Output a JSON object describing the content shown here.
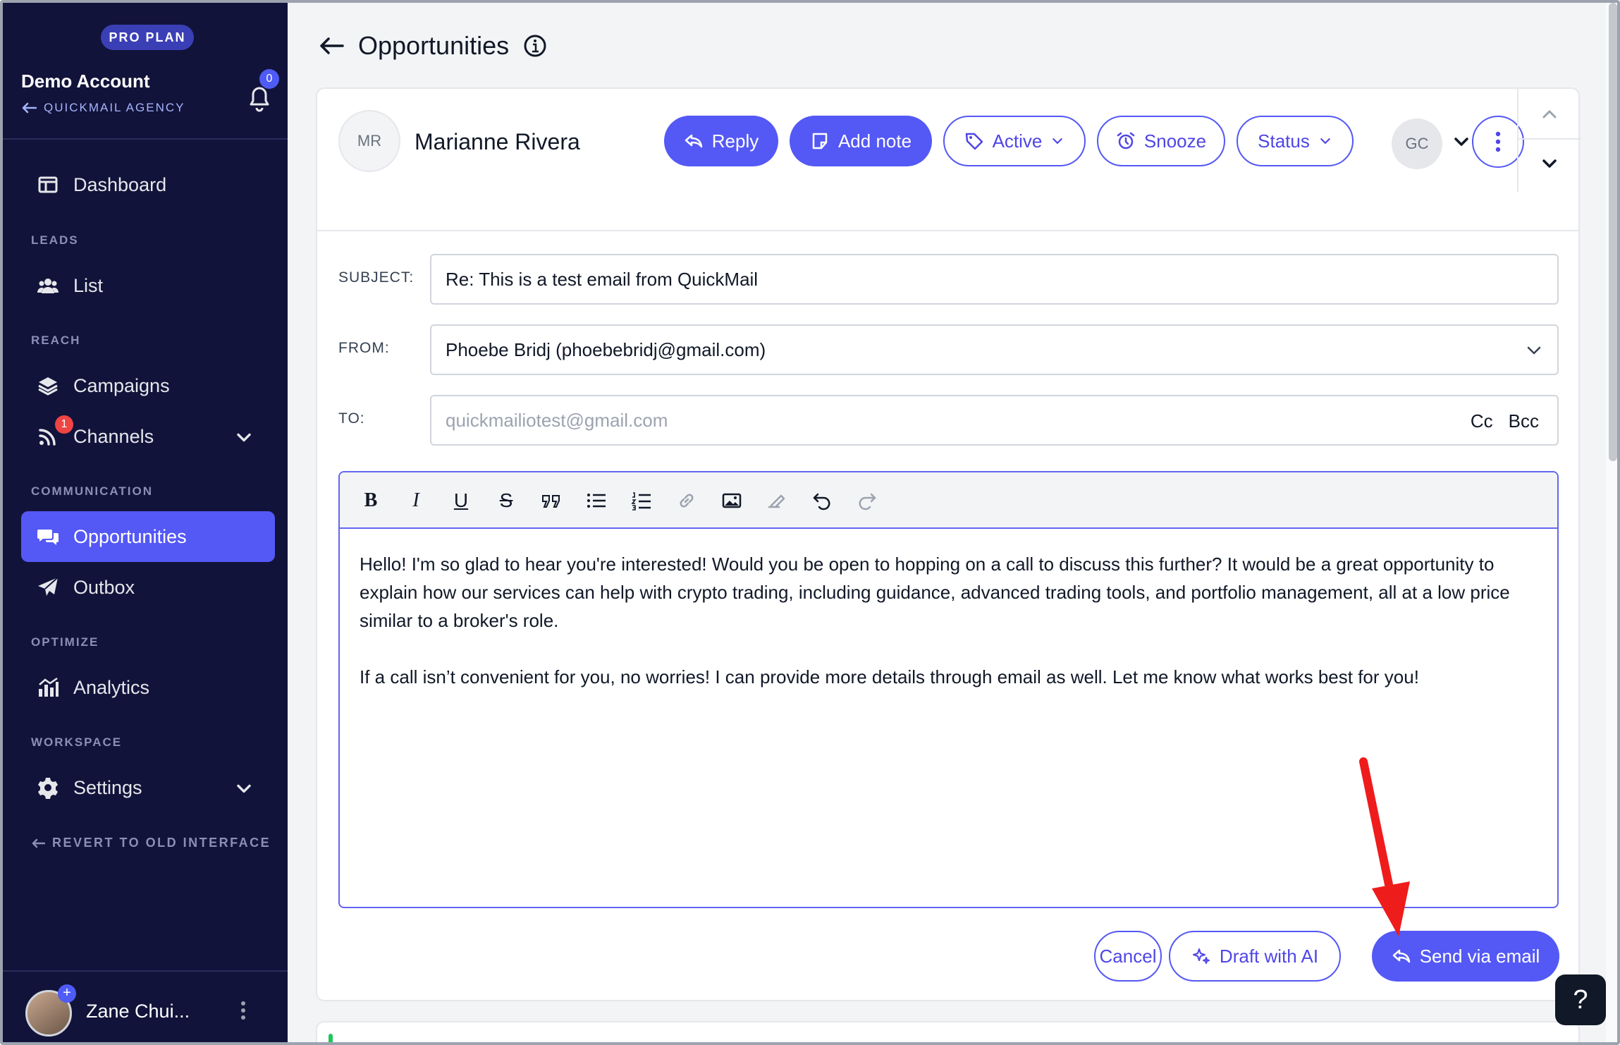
{
  "sidebar": {
    "plan_badge": "PRO PLAN",
    "account_name": "Demo Account",
    "account_sub": "QUICKMAIL AGENCY",
    "notification_count": "0",
    "sections": {
      "leads": "LEADS",
      "reach": "REACH",
      "communication": "COMMUNICATION",
      "optimize": "OPTIMIZE",
      "workspace": "WORKSPACE"
    },
    "items": {
      "dashboard": "Dashboard",
      "list": "List",
      "campaigns": "Campaigns",
      "channels": "Channels",
      "opportunities": "Opportunities",
      "outbox": "Outbox",
      "analytics": "Analytics",
      "settings": "Settings"
    },
    "channels_badge": "1",
    "revert": "REVERT TO OLD INTERFACE",
    "user_name": "Zane Chui...",
    "user_plus": "+"
  },
  "header": {
    "title": "Opportunities"
  },
  "contact": {
    "initials": "MR",
    "name": "Marianne Rivera",
    "assignee_initials": "GC"
  },
  "actions": {
    "reply": "Reply",
    "add_note": "Add note",
    "active": "Active",
    "snooze": "Snooze",
    "status": "Status"
  },
  "compose": {
    "subject_label": "SUBJECT:",
    "subject_value": "Re: This is a test email from QuickMail",
    "from_label": "FROM:",
    "from_value": "Phoebe Bridj (phoebebridj@gmail.com)",
    "to_label": "TO:",
    "to_placeholder": "quickmailiotest@gmail.com",
    "cc": "Cc",
    "bcc": "Bcc",
    "toolbar": {
      "bold": "B",
      "italic": "I",
      "underline": "U",
      "strike": "S"
    },
    "body": [
      "Hello! I'm so glad to hear you're interested! Would you be open to hopping on a call to discuss this further? It would be a great opportunity to explain how our services can help with crypto trading, including guidance, advanced trading tools, and portfolio management, all at a low price similar to a broker's role.",
      "If a call isn’t convenient for you, no worries! I can provide more details through email as well. Let me know what works best for you!"
    ],
    "cancel": "Cancel",
    "draft_ai": "Draft with AI",
    "send": "Send via email"
  },
  "help": "?",
  "colors": {
    "sidebar_bg": "#12133a",
    "accent": "#5458f5",
    "annotation": "#ef1c1c"
  }
}
